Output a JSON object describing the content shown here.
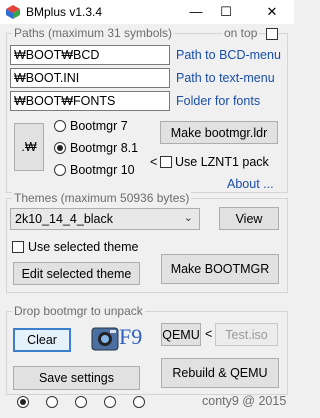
{
  "window": {
    "title": "BMplus v1.3.4",
    "minimize": "—",
    "maximize": "☐",
    "close": "✕"
  },
  "paths": {
    "legend": "Paths (maximum 31 symbols)",
    "on_top_label": "on top",
    "bcd_value": "₩BOOT₩BCD",
    "ini_value": "₩BOOT.INI",
    "fonts_value": "₩BOOT₩FONTS",
    "bcd_link": "Path to BCD-menu",
    "ini_link": "Path to text-menu",
    "fonts_link": "Folder for fonts",
    "path_sep_button": ".₩",
    "bootmgr_options": [
      "Bootmgr 7",
      "Bootmgr 8.1",
      "Bootmgr 10"
    ],
    "bootmgr_selected": "Bootmgr 8.1",
    "make_ldr_button": "Make bootmgr.ldr",
    "lznt_prefix": "<",
    "lznt_label": "Use LZNT1 pack",
    "about_link": "About ..."
  },
  "themes": {
    "legend": "Themes (maximum 50936 bytes)",
    "selected_theme": "2k10_14_4_black",
    "view_button": "View",
    "use_selected_label": "Use selected theme",
    "edit_button": "Edit selected theme",
    "make_bootmgr_button": "Make BOOTMGR"
  },
  "drop": {
    "legend": "Drop bootmgr to unpack",
    "clear_button": "Clear",
    "f9_label": "F9",
    "qemu_button": "QEMU",
    "qemu_sep": "<",
    "test_iso_button": "Test.iso",
    "save_button": "Save settings",
    "rebuild_button": "Rebuild & QEMU"
  },
  "footer": {
    "radio_count": 5,
    "selected_radio_index": 0,
    "credit": "conty9 @ 2015"
  },
  "colors": {
    "link": "#1a4ea8",
    "focus": "#3c7fd1",
    "background": "#f0f0f0"
  }
}
